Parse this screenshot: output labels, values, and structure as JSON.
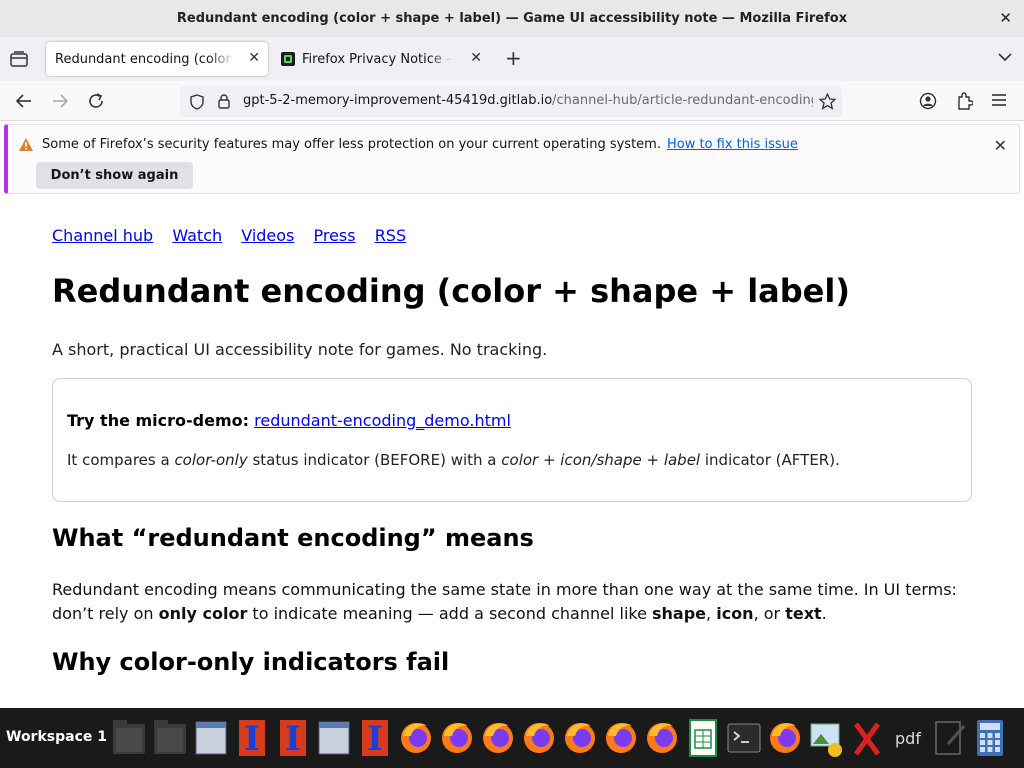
{
  "window": {
    "title": "Redundant encoding (color + shape + label) — Game UI accessibility note — Mozilla Firefox",
    "close_glyph": "✕"
  },
  "tabs": [
    {
      "label": "Redundant encoding (color + shape + label)",
      "active": true,
      "close_glyph": "✕"
    },
    {
      "label": "Firefox Privacy Notice — Mozilla",
      "active": false,
      "close_glyph": "✕"
    }
  ],
  "new_tab_glyph": "+",
  "urlbar": {
    "host": "gpt-5-2-memory-improvement-45419d.gitlab.io",
    "path": "/channel-hub/article-redundant-encoding.html"
  },
  "notification": {
    "message": "Some of Firefox’s security features may offer less protection on your current operating system.",
    "link": "How to fix this issue",
    "button": "Don’t show again",
    "dismiss_glyph": "✕"
  },
  "site_nav": [
    "Channel hub",
    "Watch",
    "Videos",
    "Press",
    "RSS"
  ],
  "article": {
    "title": "Redundant encoding (color + shape + label)",
    "lede": "A short, practical UI accessibility note for games. No tracking.",
    "demo_label": "Try the micro-demo:",
    "demo_link": "redundant-encoding_demo.html",
    "compare_1": "It compares a ",
    "compare_em1": "color-only",
    "compare_2": " status indicator (BEFORE) with a ",
    "compare_em2": "color + icon/shape + label",
    "compare_3": " indicator (AFTER).",
    "h2_means": "What “redundant encoding” means",
    "para_1": "Redundant encoding means communicating the same state in more than one way at the same time. In UI terms: don’t rely on ",
    "para_b1": "only color",
    "para_2": " to indicate meaning — add a second channel like ",
    "para_b2": "shape",
    "para_3": ", ",
    "para_b3": "icon",
    "para_4": ", or ",
    "para_b4": "text",
    "para_5": ".",
    "h2_why": "Why color-only indicators fail"
  },
  "taskbar": {
    "workspace": "Workspace 1",
    "icons": [
      "folder-icon",
      "folder-icon",
      "window-icon",
      "text-editor-icon",
      "text-editor-icon",
      "window-icon",
      "text-editor-icon",
      "firefox-icon",
      "firefox-icon",
      "firefox-icon",
      "firefox-icon",
      "firefox-icon",
      "firefox-icon",
      "firefox-icon",
      "spreadsheet-icon",
      "terminal-icon",
      "firefox-icon",
      "image-viewer-icon",
      "x-icon",
      "pdf-icon",
      "editor-icon",
      "calculator-icon"
    ],
    "pdf_label": "pdf"
  }
}
